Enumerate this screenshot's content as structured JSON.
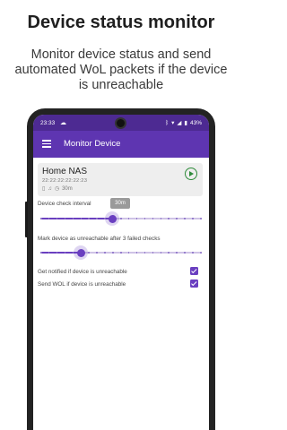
{
  "promo": {
    "headline": "Device status monitor",
    "subline": "Monitor device status and send automated WoL packets if the device is unreachable"
  },
  "statusbar": {
    "time": "23:33",
    "battery": "43%"
  },
  "appbar": {
    "title": "Monitor Device"
  },
  "device": {
    "name": "Home NAS",
    "mac": "22:22:22:22:22:23",
    "interval": "30m"
  },
  "settings": {
    "check_interval_label": "Device check interval",
    "check_interval_value": "30m",
    "check_interval_fraction": 0.45,
    "unreachable_label": "Mark device as unreachable after 3 failed checks",
    "unreachable_fraction": 0.25,
    "notify_label": "Get notified if device is unreachable",
    "notify_checked": true,
    "wol_label": "Send WOL if device is unreachable",
    "wol_checked": true
  },
  "colors": {
    "appbar": "#5e35b1",
    "statusbar": "#4d2a92",
    "accent": "#6a3fc0",
    "play": "#2e8b3a"
  },
  "icons": [
    "menu-icon",
    "play-icon",
    "cloud-icon",
    "bluetooth-icon",
    "wifi-icon",
    "battery-icon",
    "phone-icon",
    "bell-icon",
    "clock-icon"
  ]
}
